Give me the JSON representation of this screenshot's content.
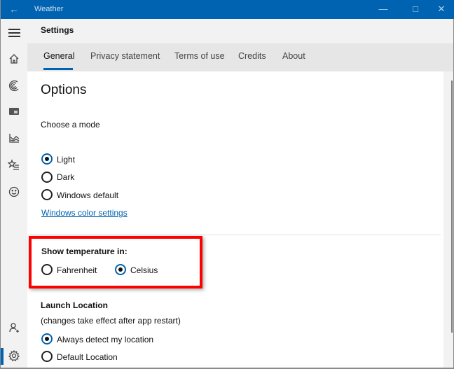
{
  "window": {
    "app_title": "Weather",
    "controls": {
      "back": "back-arrow-icon",
      "minimize": "minimize-icon",
      "maximize": "maximize-icon",
      "close": "close-icon"
    },
    "accent_color": "#0063b1"
  },
  "header": {
    "title": "Settings"
  },
  "sidebar": {
    "items": [
      {
        "name": "menu",
        "icon": "hamburger-icon"
      },
      {
        "name": "forecast",
        "icon": "home-icon"
      },
      {
        "name": "maps",
        "icon": "radar-icon"
      },
      {
        "name": "news",
        "icon": "news-icon"
      },
      {
        "name": "historical-weather",
        "icon": "chart-icon"
      },
      {
        "name": "places",
        "icon": "favorites-icon"
      },
      {
        "name": "feedback",
        "icon": "smiley-icon"
      },
      {
        "name": "account",
        "icon": "add-person-icon"
      },
      {
        "name": "settings",
        "icon": "gear-icon",
        "selected": true
      }
    ]
  },
  "tabs": [
    {
      "label": "General",
      "active": true
    },
    {
      "label": "Privacy statement"
    },
    {
      "label": "Terms of use"
    },
    {
      "label": "Credits"
    },
    {
      "label": "About"
    }
  ],
  "options": {
    "heading": "Options",
    "mode": {
      "label": "Choose a mode",
      "choices": [
        {
          "label": "Light",
          "checked": true
        },
        {
          "label": "Dark",
          "checked": false
        },
        {
          "label": "Windows default",
          "checked": false
        }
      ],
      "link": "Windows color settings"
    },
    "temperature": {
      "label": "Show temperature in:",
      "choices": [
        {
          "label": "Fahrenheit",
          "checked": false
        },
        {
          "label": "Celsius",
          "checked": true
        }
      ],
      "highlight_color": "#ff0000"
    },
    "launch": {
      "label": "Launch Location",
      "note": "(changes take effect after app restart)",
      "choices": [
        {
          "label": "Always detect my location",
          "checked": true
        },
        {
          "label": "Default Location",
          "checked": false
        }
      ]
    }
  }
}
